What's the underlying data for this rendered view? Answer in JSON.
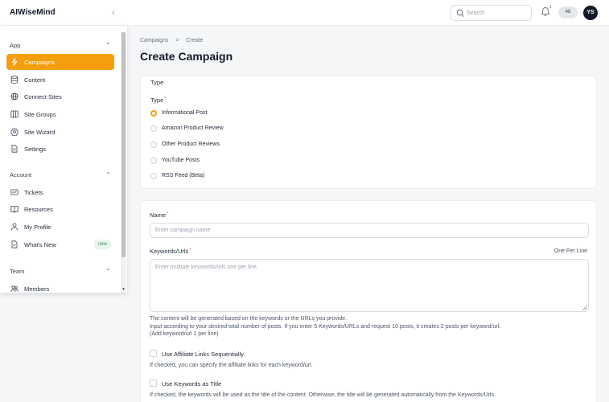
{
  "app": {
    "title": "AIWiseMind"
  },
  "header": {
    "search_placeholder": "Search",
    "notification_count": "1",
    "credits": "48",
    "avatar_initials": "YS"
  },
  "sidebar": {
    "sections": [
      {
        "label": "App",
        "items": [
          {
            "label": "Campaigns",
            "icon": "lightning-icon",
            "active": true
          },
          {
            "label": "Content",
            "icon": "database-icon"
          },
          {
            "label": "Connect Sites",
            "icon": "globe-icon"
          },
          {
            "label": "Site Groups",
            "icon": "columns-icon"
          },
          {
            "label": "Site Wizard",
            "icon": "gear-icon"
          },
          {
            "label": "Settings",
            "icon": "document-icon"
          }
        ]
      },
      {
        "label": "Account",
        "items": [
          {
            "label": "Tickets",
            "icon": "ticket-icon"
          },
          {
            "label": "Resources",
            "icon": "book-icon"
          },
          {
            "label": "My Profile",
            "icon": "user-icon"
          },
          {
            "label": "What's New",
            "icon": "news-icon",
            "badge": "new"
          }
        ]
      },
      {
        "label": "Team",
        "items": [
          {
            "label": "Members",
            "icon": "members-icon"
          }
        ]
      }
    ]
  },
  "breadcrumb": {
    "parent": "Campaigns",
    "separator": ">",
    "current": "Create"
  },
  "page": {
    "title": "Create Campaign"
  },
  "type_card": {
    "heading": "Type",
    "field_label": "Type",
    "required_mark": "*",
    "options": [
      {
        "label": "Informational Post",
        "checked": true
      },
      {
        "label": "Amazon Product Review",
        "checked": false
      },
      {
        "label": "Other Product Reviews",
        "checked": false
      },
      {
        "label": "YouTube Posts",
        "checked": false
      },
      {
        "label": "RSS Feed (Beta)",
        "checked": false
      }
    ]
  },
  "form": {
    "name_label": "Name",
    "name_placeholder": "Enter campaign name",
    "keywords_label": "Keywords/Urls",
    "keywords_aside": "One Per Line",
    "keywords_placeholder": "Enter multiple keywords/urls one per line.",
    "keywords_help_1": "The content will be generated based on the keywords or the URLs you provide.",
    "keywords_help_2": "Input according to your desired total number of posts. If you enter 5 Keywords/URLs and request 10 posts, it creates 2 posts per keyword/url.",
    "keywords_help_3": "(Add keyword/url 1 per line)",
    "affiliate_label": "Use Affiliate Links Sequentially",
    "affiliate_help": "If checked, you can specify the affiliate links for each keyword/url.",
    "title_label": "Use Keywords as Title",
    "title_help": "If checked, the keywords will be used as the title of the content. Otherwise, the title will be generated automatically from the Keywords/Urls."
  },
  "colors": {
    "accent": "#f59e0b",
    "new_badge_bg": "#e7f5ee",
    "new_badge_text": "#4b8b6b"
  }
}
